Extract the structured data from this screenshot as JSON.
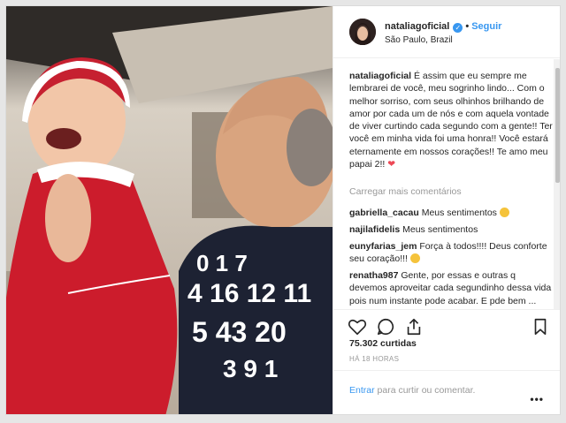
{
  "header": {
    "username": "nataliagoficial",
    "follow_label": "Seguir",
    "location": "São Paulo, Brazil"
  },
  "caption": {
    "username": "nataliagoficial",
    "text": "É assim que eu sempre me lembrarei de você, meu sogrinho lindo... Com o melhor sorriso, com seus olhinhos brilhando de amor por cada um de nós e com aquela vontade de viver curtindo cada segundo com a gente!! Ter você em minha vida foi uma honra!! Você estará eternamente em nossos corações!! Te amo meu papai 2!!"
  },
  "load_more_label": "Carregar mais comentários",
  "comments": [
    {
      "username": "gabriella_cacau",
      "text": "Meus sentimentos"
    },
    {
      "username": "najilafidelis",
      "text": "Meus sentimentos"
    },
    {
      "username": "eunyfarias_jem",
      "text": "Força à todos!!!! Deus conforte seu coração!!!"
    },
    {
      "username": "renatha987",
      "text": "Gente, por essas e outras q devemos aproveitar cada segundinho dessa vida pois num instante pode acabar. E pde bem ..."
    }
  ],
  "likes": "75.302 curtidas",
  "timestamp": "HÁ 18 HORAS",
  "footer": {
    "login_link": "Entrar",
    "login_text": "para curtir ou comentar."
  },
  "icons": [
    "verified-icon",
    "heart-icon",
    "comment-icon",
    "share-icon",
    "bookmark-icon",
    "more-options-icon",
    "sad-face-icon"
  ]
}
